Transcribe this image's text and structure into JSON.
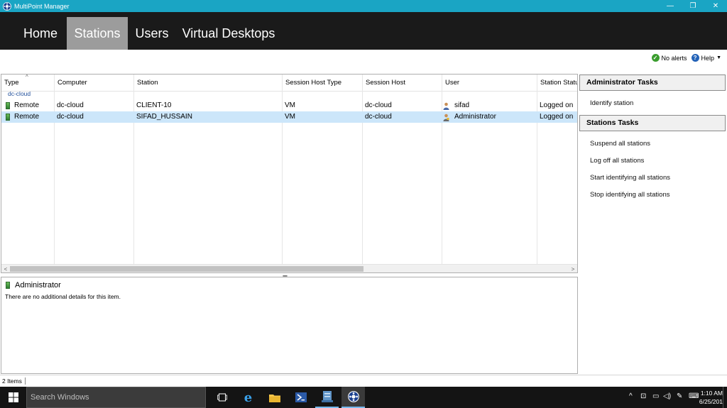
{
  "window": {
    "title": "MultiPoint Manager",
    "controls": [
      "—",
      "❐",
      "✕"
    ]
  },
  "nav": {
    "tabs": [
      {
        "label": "Home"
      },
      {
        "label": "Stations"
      },
      {
        "label": "Users"
      },
      {
        "label": "Virtual Desktops"
      }
    ],
    "active": "Stations"
  },
  "alerts": {
    "status": "No alerts",
    "help": "Help"
  },
  "grid": {
    "columns": [
      "Type",
      "Computer",
      "Station",
      "Session Host Type",
      "Session Host",
      "User",
      "Station Statu"
    ],
    "group": "dc-cloud",
    "rows": [
      {
        "type": "Remote",
        "computer": "dc-cloud",
        "station": "CLIENT-10",
        "host_type": "VM",
        "host": "dc-cloud",
        "user": "sifad",
        "status": "Logged on"
      },
      {
        "type": "Remote",
        "computer": "dc-cloud",
        "station": "SIFAD_HUSSAIN",
        "host_type": "VM",
        "host": "dc-cloud",
        "user": "Administrator",
        "status": "Logged on"
      }
    ]
  },
  "details": {
    "title": "Administrator",
    "note": "There are no additional details for this item."
  },
  "tasks": {
    "admin": {
      "title": "Administrator Tasks",
      "items": [
        "Identify station"
      ]
    },
    "stations": {
      "title": "Stations Tasks",
      "items": [
        "Suspend all stations",
        "Log off all stations",
        "Start identifying all stations",
        "Stop identifying all stations"
      ]
    }
  },
  "status": {
    "count": "2 Items"
  },
  "taskbar": {
    "search_placeholder": "Search Windows",
    "time": "1:10 AM",
    "date": "6/25/201"
  },
  "colors": {
    "titlebar": "#1aa5c4",
    "nav_bg": "#1a1a1a",
    "nav_active": "#9c9c9c",
    "selected_row": "#cce6fa",
    "group_link": "#1f4e9a"
  }
}
